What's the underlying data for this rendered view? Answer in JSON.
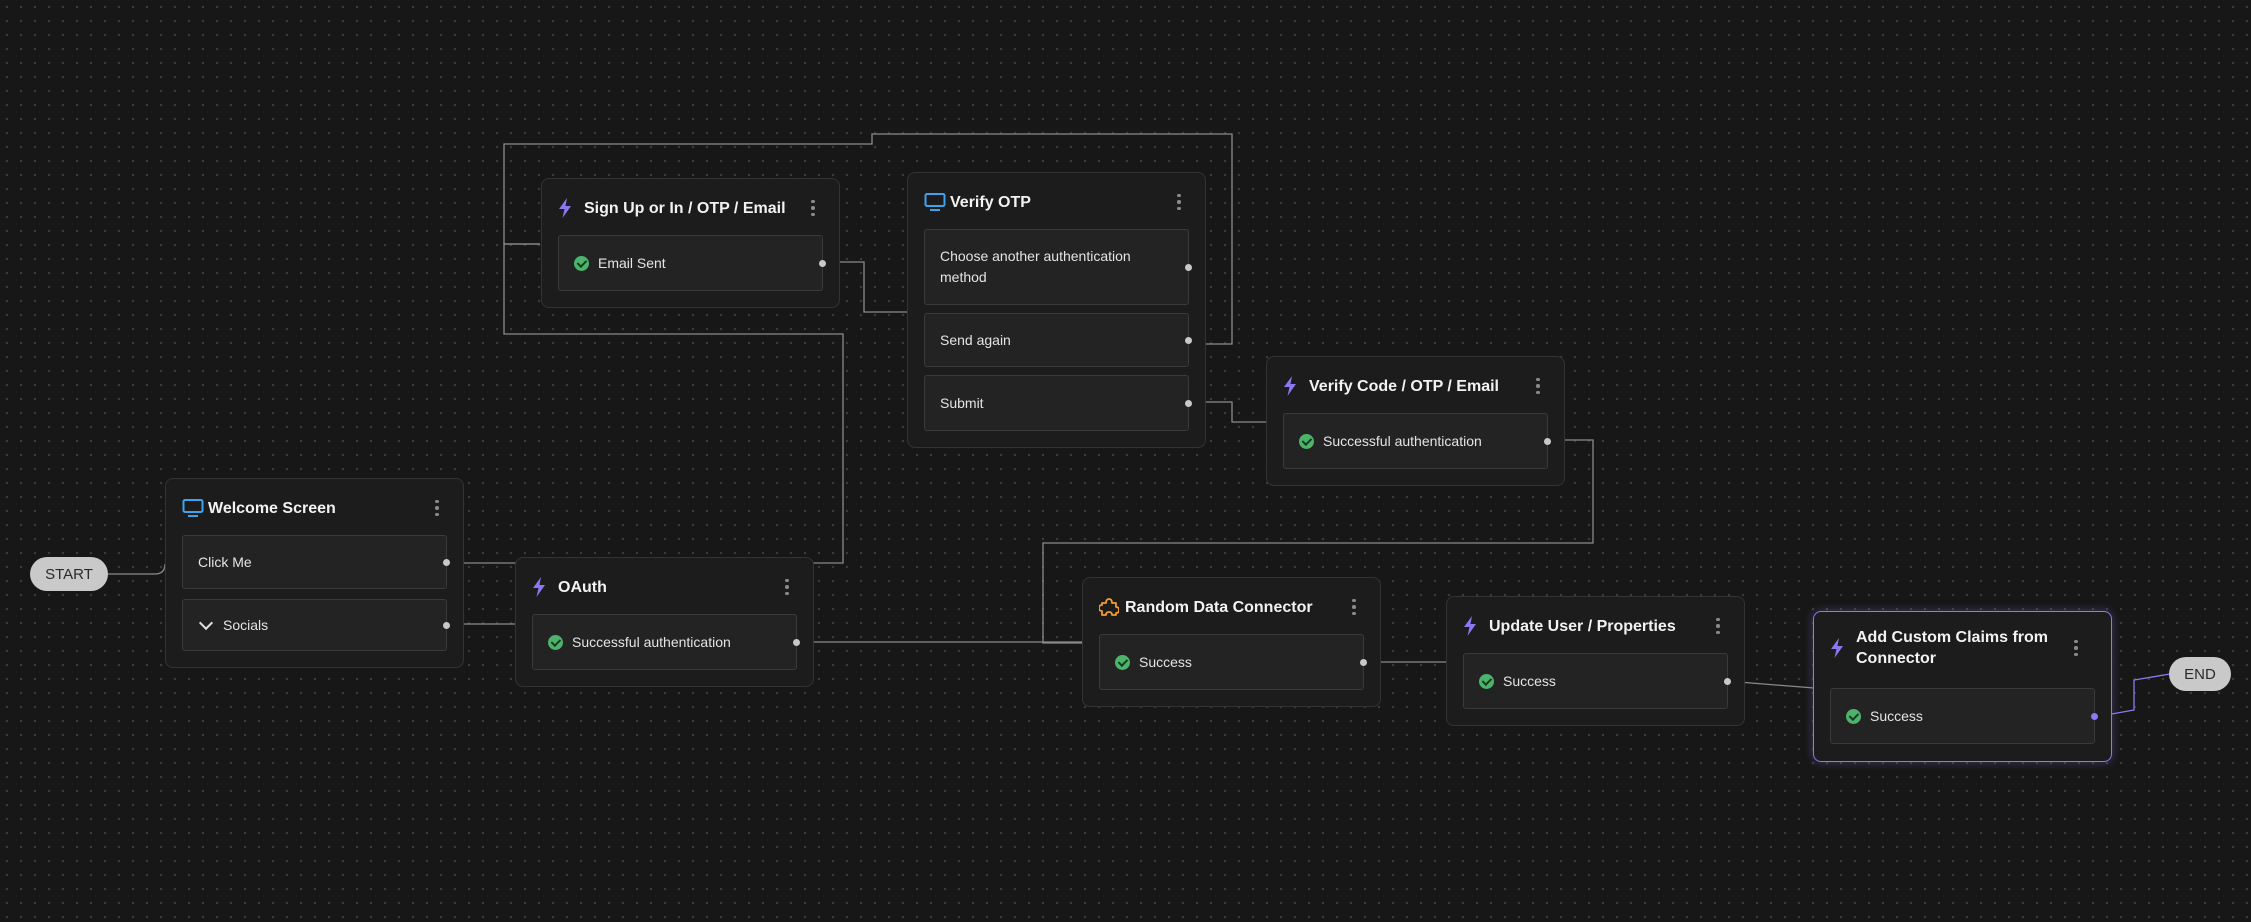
{
  "colors": {
    "background": "#171717",
    "node_background": "#1c1c1c",
    "action_icon": "#8b78f0",
    "screen_icon": "#3ea3ee",
    "connector_icon": "#f39c33",
    "success_check": "#4cb36a",
    "selected_border": "#8d79f0"
  },
  "start_label": "START",
  "end_label": "END",
  "nodes": {
    "welcome": {
      "title": "Welcome Screen",
      "icon": "monitor-icon",
      "rows": [
        "Click Me",
        "Socials"
      ]
    },
    "signup": {
      "title": "Sign Up or In / OTP / Email",
      "icon": "lightning-icon",
      "rows": [
        "Email Sent"
      ]
    },
    "verify_otp": {
      "title": "Verify OTP",
      "icon": "monitor-icon",
      "rows": [
        "Choose another authentication method",
        "Send again",
        "Submit"
      ]
    },
    "verify_code": {
      "title": "Verify Code / OTP / Email",
      "icon": "lightning-icon",
      "rows": [
        "Successful authentication"
      ]
    },
    "oauth": {
      "title": "OAuth",
      "icon": "lightning-icon",
      "rows": [
        "Successful authentication"
      ]
    },
    "random_data": {
      "title": "Random Data Connector",
      "icon": "puzzle-icon",
      "rows": [
        "Success"
      ]
    },
    "update_user": {
      "title": "Update User / Properties",
      "icon": "lightning-icon",
      "rows": [
        "Success"
      ]
    },
    "custom_claims": {
      "title": "Add Custom Claims from Connector",
      "icon": "lightning-icon",
      "rows": [
        "Success"
      ]
    }
  }
}
